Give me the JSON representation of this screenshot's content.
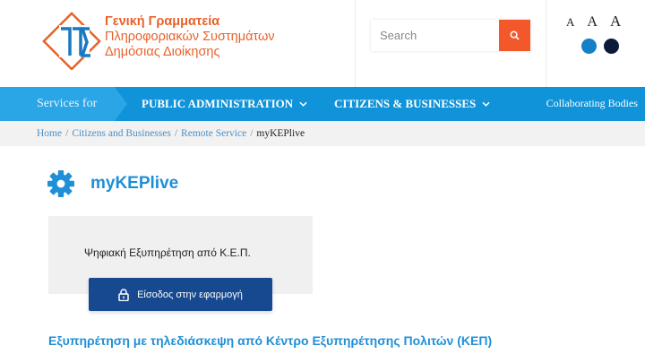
{
  "header": {
    "logo_lines": [
      "Γενική Γραμματεία",
      "Πληροφοριακών Συστημάτων",
      "Δημόσιας Διοίκησης"
    ],
    "search_placeholder": "Search",
    "font_size_options": [
      "A",
      "A",
      "A"
    ],
    "contrast_colors": [
      "#1480c6",
      "#0d1a3a"
    ]
  },
  "nav": {
    "services_label": "Services for",
    "items": [
      {
        "label": "PUBLIC ADMINISTRATION"
      },
      {
        "label": "CITIZENS & BUSINESSES"
      }
    ],
    "right_link": "Collaborating Bodies"
  },
  "breadcrumb": [
    "Home",
    "Citizens and Businesses",
    "Remote Service",
    "myKEPlive"
  ],
  "main": {
    "title": "myKEPlive",
    "card_text": "Ψηφιακή Εξυπηρέτηση από Κ.Ε.Π.",
    "login_button": "Είσοδος στην εφαρμογή",
    "subheading": "Εξυπηρέτηση με τηλεδιάσκεψη από Κέντρο Εξυπηρέτησης Πολιτών (ΚΕΠ)"
  },
  "colors": {
    "accent_orange": "#f2582a",
    "nav_blue": "#1093d8",
    "title_blue": "#1f8fd6",
    "button_navy": "#16498f"
  }
}
